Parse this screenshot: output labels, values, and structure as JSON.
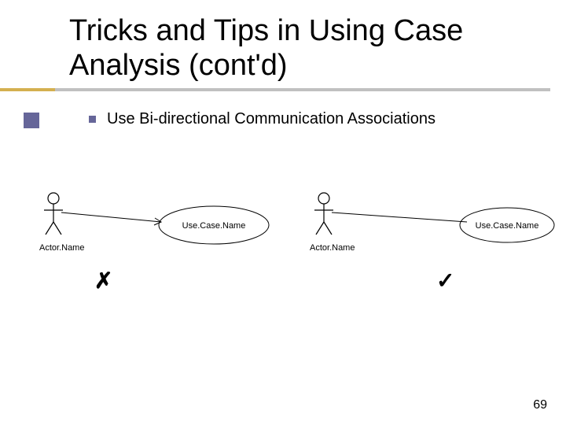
{
  "title": "Tricks and Tips in Using Case Analysis (cont'd)",
  "bullet": {
    "text": "Use Bi-directional Communication Associations"
  },
  "left": {
    "actor_label": "Actor.Name",
    "usecase_label": "Use.Case.Name",
    "mark": "✗"
  },
  "right": {
    "actor_label": "Actor.Name",
    "usecase_label": "Use.Case.Name",
    "mark": "✓"
  },
  "page_number": "69"
}
